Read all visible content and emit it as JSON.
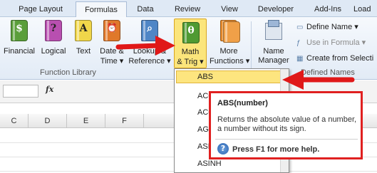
{
  "ribbon_tabs": [
    "Page Layout",
    "Formulas",
    "Data",
    "Review",
    "View",
    "Developer",
    "Add-Ins",
    "Load"
  ],
  "function_library": {
    "buttons": [
      {
        "l1": "Financial",
        "l2": "",
        "icon": "financial-book-icon"
      },
      {
        "l1": "Logical",
        "l2": "",
        "icon": "logical-book-icon"
      },
      {
        "l1": "Text",
        "l2": "",
        "icon": "text-book-icon"
      },
      {
        "l1": "Date &",
        "l2": "Time ▾",
        "icon": "date-time-book-icon"
      },
      {
        "l1": "Lookup &",
        "l2": "Reference ▾",
        "icon": "lookup-book-icon"
      },
      {
        "l1": "Math",
        "l2": "& Trig ▾",
        "icon": "math-trig-book-icon"
      },
      {
        "l1": "More",
        "l2": "Functions ▾",
        "icon": "more-functions-book-icon"
      }
    ],
    "group_label": "Function Library"
  },
  "defined_names": {
    "name_manager": {
      "l1": "Name",
      "l2": "Manager"
    },
    "define_name": "Define Name ▾",
    "use_in_formula": "Use in Formula ▾",
    "create_from_selection": "Create from Selecti",
    "group_label": "Defined Names"
  },
  "formula_bar": {
    "fx": "fx"
  },
  "columns": [
    "C",
    "D",
    "E",
    "F"
  ],
  "math_trig_menu": [
    "ABS",
    "ACOS",
    "ACOSH",
    "AGGREGATE",
    "ASIN",
    "ASINH"
  ],
  "tooltip": {
    "title": "ABS(number)",
    "description": "Returns the absolute value of a number, a number without its sign.",
    "help": "Press F1 for more help."
  },
  "colors": {
    "highlight": "#fbe57b",
    "arrow": "#e01818",
    "tooltip_border": "#e02020"
  }
}
